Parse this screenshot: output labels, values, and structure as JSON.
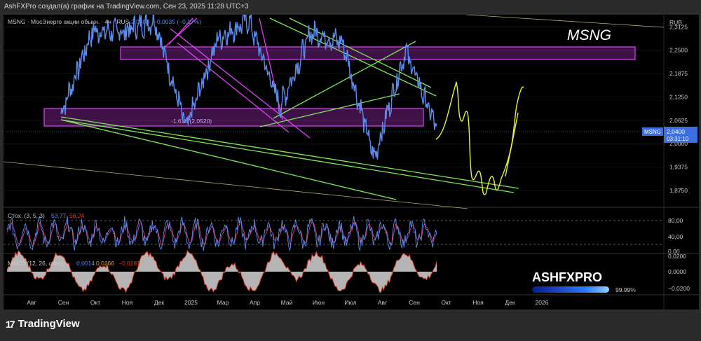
{
  "header": {
    "text": "AshFXPro создал(а) график на TradingView.com, Сен 23, 2025 11:28 UTC+3"
  },
  "legend": {
    "symbol_line": "MSNG · МосЭнерго акции обыкн. · 4ч · RUS",
    "price": "2,0400",
    "change": "−0,0035 (−0,17%)"
  },
  "watermark": "MSNG",
  "fib_label": "-1,618 (2,0520)",
  "price_badge": {
    "symbol": "MSNG",
    "price": "2,0400",
    "timer": "03:31:10"
  },
  "currency": "RUB",
  "branding": {
    "title": "ASHFXPRO",
    "percent": "99.99%"
  },
  "footer": {
    "logo": "TradingView"
  },
  "colors": {
    "price": "#5b8def",
    "fib_zone": "#e040fb",
    "trend": "#7ee857",
    "projection": "#e8f23a",
    "macd_hist": "#b5b5b5",
    "macd_line": "#e23b2b"
  },
  "chart_data": [
    {
      "type": "line",
      "title": "MSNG",
      "series": [
        {
          "name": "MSNG",
          "x": [
            "Авг",
            "Сен",
            "Окт",
            "Ноя",
            "Дек",
            "2025",
            "Мар",
            "Апр",
            "Май",
            "Июн",
            "Июл",
            "Авг",
            "Сен"
          ],
          "values": [
            2.08,
            2.3,
            2.3,
            2.33,
            2.04,
            2.28,
            2.33,
            2.1,
            2.3,
            2.27,
            1.96,
            2.25,
            2.04
          ]
        }
      ],
      "x_ticks": [
        "Авг",
        "Сен",
        "Окт",
        "Ноя",
        "Дек",
        "2025",
        "Мар",
        "Апр",
        "Май",
        "Июн",
        "Июл",
        "Авг",
        "Сен",
        "Окт",
        "Ноя",
        "Дек",
        "2026"
      ],
      "y_ticks": [
        "2,3125",
        "2,2500",
        "2,1875",
        "2,1250",
        "2,0625",
        "2,0000",
        "1,9375",
        "1,8750"
      ],
      "ylim": [
        1.83,
        2.345
      ]
    },
    {
      "type": "line",
      "title": "Стох. (3, 5, 3)",
      "series": [
        {
          "name": "%K",
          "value": "53,77"
        },
        {
          "name": "%D",
          "value": "56,24"
        }
      ],
      "y_ticks": [
        "80,00",
        "40,00",
        "0,00"
      ]
    },
    {
      "type": "bar",
      "title": "MACD (12, 26, close)",
      "series": [
        {
          "name": "macd",
          "value": "0,0014"
        },
        {
          "name": "signal",
          "value": "0,0266"
        },
        {
          "name": "histogram",
          "value": "−0,0281"
        }
      ],
      "y_ticks": [
        "0,0200",
        "0,0000",
        "−0,0200"
      ]
    }
  ]
}
